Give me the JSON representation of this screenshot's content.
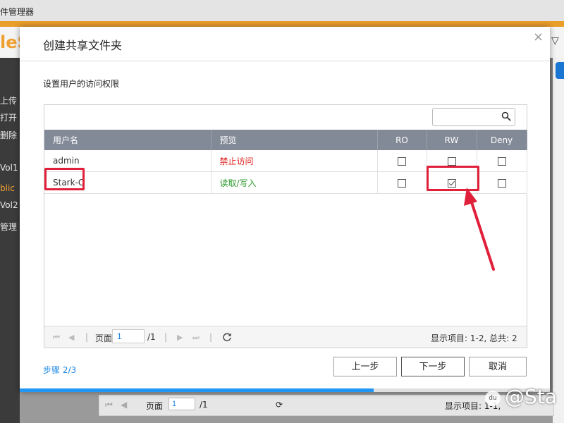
{
  "app": {
    "window_title": "件管理器",
    "logo_text": "leS",
    "sidebar": [
      {
        "label": "上传",
        "active": false
      },
      {
        "label": "打开",
        "active": false
      },
      {
        "label": "删除",
        "active": false
      },
      {
        "label": "Vol1",
        "active": false
      },
      {
        "label": "blic",
        "active": true
      },
      {
        "label": "Vol2",
        "active": false
      },
      {
        "label": "管理",
        "active": false
      }
    ],
    "bottom_pager": {
      "page_label": "页面",
      "page_value": "1",
      "total": "/1",
      "items_label": "显示项目: 1-1,"
    }
  },
  "dialog": {
    "title": "创建共享文件夹",
    "close_label": "×",
    "subtitle": "设置用户的访问权限",
    "search_placeholder": "",
    "columns": {
      "user": "用户名",
      "preview": "预览",
      "ro": "RO",
      "rw": "RW",
      "deny": "Deny"
    },
    "rows": [
      {
        "user": "admin",
        "preview": "禁止访问",
        "preview_type": "deny",
        "ro": false,
        "rw": false,
        "deny": false
      },
      {
        "user": "Stark-C",
        "preview": "读取/写入",
        "preview_type": "allow",
        "ro": false,
        "rw": true,
        "deny": false
      }
    ],
    "pager": {
      "page_label": "页面",
      "page_value": "1",
      "total": "/1",
      "items": "显示项目:  1-2, 总共:  2"
    },
    "step": "步骤 2/3",
    "buttons": {
      "prev": "上一步",
      "next": "下一步",
      "cancel": "取消"
    },
    "progress_fraction": 0.667
  },
  "watermark": "@Sta",
  "colors": {
    "accent": "#2196f3",
    "orange": "#e99e2a",
    "highlight": "#e0203a",
    "deny": "#e02020",
    "allow": "#2e9a2e",
    "header": "#828a97"
  }
}
